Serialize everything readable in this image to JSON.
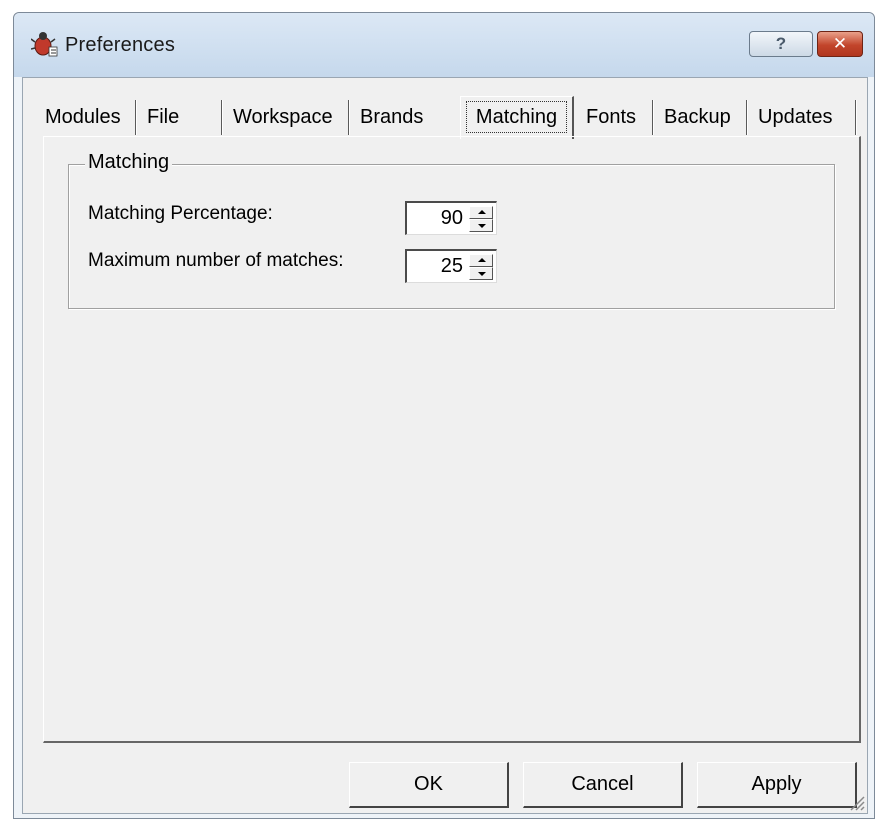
{
  "window": {
    "title": "Preferences",
    "help_label": "?",
    "close_label": "✕"
  },
  "tabs": [
    {
      "label": "Modules"
    },
    {
      "label": "File"
    },
    {
      "label": "Workspace"
    },
    {
      "label": "Brands"
    },
    {
      "label": "Matching",
      "selected": true
    },
    {
      "label": "Fonts"
    },
    {
      "label": "Backup"
    },
    {
      "label": "Updates"
    }
  ],
  "matching_group": {
    "title": "Matching",
    "fields": [
      {
        "label": "Matching Percentage:",
        "value": "90"
      },
      {
        "label": "Maximum number of matches:",
        "value": "25"
      }
    ]
  },
  "buttons": {
    "ok": "OK",
    "cancel": "Cancel",
    "apply": "Apply"
  },
  "icons": {
    "app": "bug-icon",
    "help": "help-icon",
    "close": "close-icon",
    "spin_up": "spin-up-icon",
    "spin_down": "spin-down-icon",
    "resize": "resize-grip-icon"
  }
}
